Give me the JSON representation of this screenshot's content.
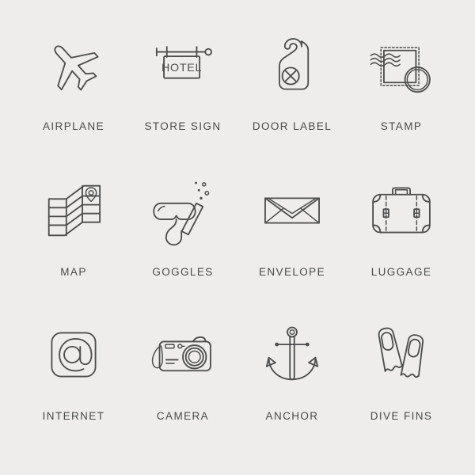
{
  "page": {
    "background_color": "#eeedeb",
    "stroke_color": "#4d4d4d",
    "label_color": "#4a4a4a",
    "columns": 4,
    "rows": 3
  },
  "icons": [
    {
      "id": "airplane",
      "label": "AIRPLANE",
      "icon_name": "airplane-icon"
    },
    {
      "id": "store-sign",
      "label": "STORE SIGN",
      "icon_name": "store-sign-icon",
      "sign_text": "HOTEL"
    },
    {
      "id": "door-label",
      "label": "DOOR LABEL",
      "icon_name": "door-label-icon"
    },
    {
      "id": "stamp",
      "label": "STAMP",
      "icon_name": "stamp-icon"
    },
    {
      "id": "map",
      "label": "MAP",
      "icon_name": "map-icon"
    },
    {
      "id": "goggles",
      "label": "GOGGLES",
      "icon_name": "goggles-icon"
    },
    {
      "id": "envelope",
      "label": "ENVELOPE",
      "icon_name": "envelope-icon"
    },
    {
      "id": "luggage",
      "label": "LUGGAGE",
      "icon_name": "luggage-icon"
    },
    {
      "id": "internet",
      "label": "INTERNET",
      "icon_name": "internet-at-icon"
    },
    {
      "id": "camera",
      "label": "CAMERA",
      "icon_name": "camera-icon"
    },
    {
      "id": "anchor",
      "label": "ANCHOR",
      "icon_name": "anchor-icon"
    },
    {
      "id": "dive-fins",
      "label": "DIVE FINS",
      "icon_name": "dive-fins-icon"
    }
  ]
}
